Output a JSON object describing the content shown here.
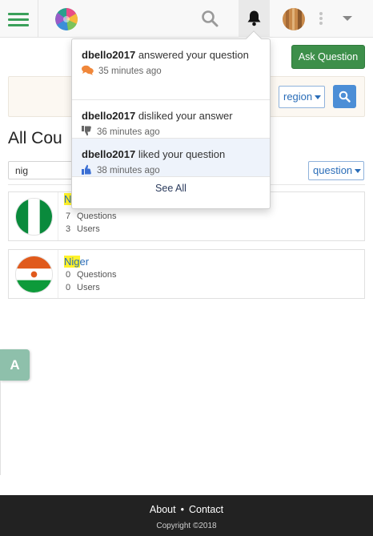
{
  "header": {
    "menu_icon": "hamburger-icon",
    "search_icon": "search-icon",
    "bell_icon": "bell-icon",
    "more_icon": "kebab-icon",
    "caret_icon": "caret-down-icon",
    "accent_color": "#3aa05a"
  },
  "ask_button": {
    "label": "Ask Question",
    "color": "#3d8f4a"
  },
  "region_filter": {
    "selected": "region",
    "search_icon": "search-icon"
  },
  "page": {
    "title": "All Cou",
    "filter_value": "nig",
    "type_select": "question"
  },
  "countries": [
    {
      "name_highlight": "Ni",
      "name_rest": "",
      "questions_count": "7",
      "questions_label": "Questions",
      "users_count": "3",
      "users_label": "Users"
    },
    {
      "name_highlight": "Nig",
      "name_rest": "er",
      "questions_count": "0",
      "questions_label": "Questions",
      "users_count": "0",
      "users_label": "Users"
    }
  ],
  "notifications": {
    "items": [
      {
        "user": "dbello2017",
        "action": " answered your question",
        "time": "35 minutes ago",
        "icon": "comments-icon",
        "icon_color": "#f0873a"
      },
      {
        "user": "dbello2017",
        "action": " disliked your answer",
        "time": "36 minutes ago",
        "icon": "thumbs-down-icon",
        "icon_color": "#666666"
      },
      {
        "user": "dbello2017",
        "action": " liked your question",
        "time": "38 minutes ago",
        "icon": "thumbs-up-icon",
        "icon_color": "#3b6fd4"
      }
    ],
    "see_all": "See All"
  },
  "side_tab": {
    "label": "A",
    "color": "#8ec0ab"
  },
  "footer": {
    "about": "About",
    "separator": "•",
    "contact": "Contact",
    "copyright": "Copyright ©2018"
  }
}
